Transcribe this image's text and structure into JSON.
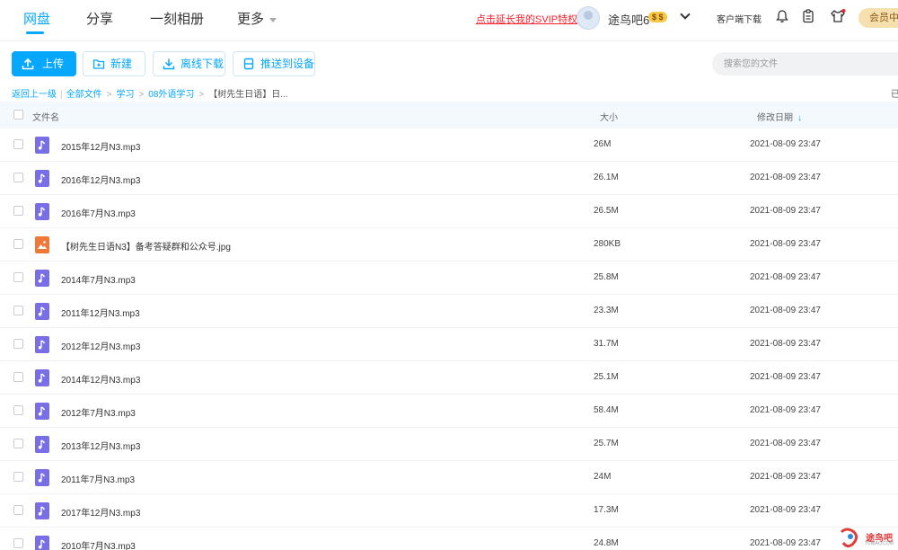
{
  "nav": {
    "tabs": [
      {
        "label": "网盘",
        "active": true
      },
      {
        "label": "分享",
        "active": false
      },
      {
        "label": "一刻相册",
        "active": false
      },
      {
        "label": "更多",
        "active": false
      }
    ],
    "svip_link": "点击延长我的SVIP特权",
    "username": "途鸟吧6",
    "vip_badge": "$ $",
    "client_download": "客户端下载",
    "member_center": "会员中心"
  },
  "toolbar": {
    "upload": "上传",
    "new": "新建",
    "offline_download": "离线下载",
    "push_to_device": "推送到设备",
    "search_placeholder": "搜索您的文件"
  },
  "breadcrumb": {
    "back": "返回上一级",
    "all_files": "全部文件",
    "level1": "学习",
    "level2": "08外语学习",
    "current": "【树先生日语】日...",
    "right_edge": "已"
  },
  "table": {
    "headers": {
      "name": "文件名",
      "size": "大小",
      "modified": "修改日期"
    },
    "rows": [
      {
        "name": "2015年12月N3.mp3",
        "size": "26M",
        "date": "2021-08-09 23:47",
        "type": "audio"
      },
      {
        "name": "2016年12月N3.mp3",
        "size": "26.1M",
        "date": "2021-08-09 23:47",
        "type": "audio"
      },
      {
        "name": "2016年7月N3.mp3",
        "size": "26.5M",
        "date": "2021-08-09 23:47",
        "type": "audio"
      },
      {
        "name": "【树先生日语N3】备考答疑群和公众号.jpg",
        "size": "280KB",
        "date": "2021-08-09 23:47",
        "type": "image"
      },
      {
        "name": "2014年7月N3.mp3",
        "size": "25.8M",
        "date": "2021-08-09 23:47",
        "type": "audio"
      },
      {
        "name": "2011年12月N3.mp3",
        "size": "23.3M",
        "date": "2021-08-09 23:47",
        "type": "audio"
      },
      {
        "name": "2012年12月N3.mp3",
        "size": "31.7M",
        "date": "2021-08-09 23:47",
        "type": "audio"
      },
      {
        "name": "2014年12月N3.mp3",
        "size": "25.1M",
        "date": "2021-08-09 23:47",
        "type": "audio"
      },
      {
        "name": "2012年7月N3.mp3",
        "size": "58.4M",
        "date": "2021-08-09 23:47",
        "type": "audio"
      },
      {
        "name": "2013年12月N3.mp3",
        "size": "25.7M",
        "date": "2021-08-09 23:47",
        "type": "audio"
      },
      {
        "name": "2011年7月N3.mp3",
        "size": "24M",
        "date": "2021-08-09 23:47",
        "type": "audio"
      },
      {
        "name": "2017年12月N3.mp3",
        "size": "17.3M",
        "date": "2021-08-09 23:47",
        "type": "audio"
      },
      {
        "name": "2010年7月N3.mp3",
        "size": "24.8M",
        "date": "2021-08-09 23:47",
        "type": "audio"
      }
    ]
  },
  "watermark": {
    "text": "途鸟吧",
    "sub": "TUNIAO.COM"
  },
  "colors": {
    "accent": "#06a7ff",
    "svip": "#f5222d",
    "audio_icon": "#7a6ee6",
    "image_icon": "#f07838"
  }
}
